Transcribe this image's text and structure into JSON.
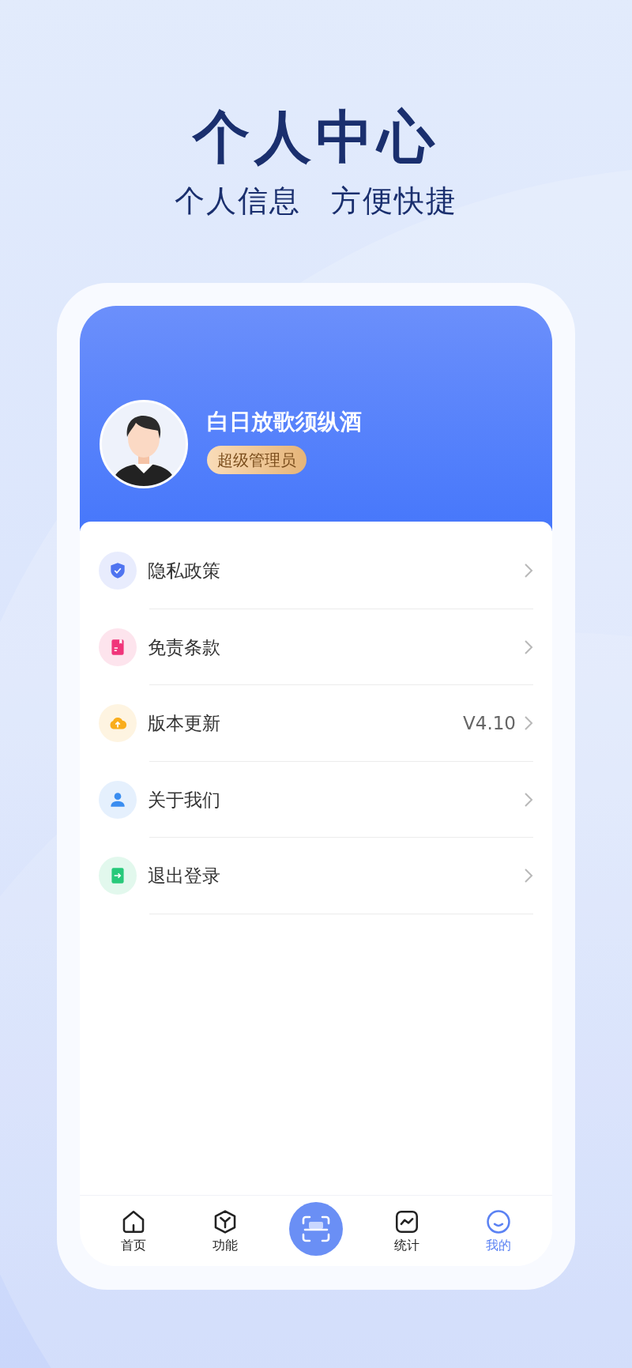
{
  "headline": {
    "title": "个人中心",
    "subtitle": [
      "个人信息",
      "方便快捷"
    ]
  },
  "profile": {
    "name": "白日放歌须纵酒",
    "role": "超级管理员"
  },
  "menu": [
    {
      "kind": "shield",
      "label": "隐私政策",
      "color": "#4f74f0"
    },
    {
      "kind": "document",
      "label": "免责条款",
      "color": "#f0357a"
    },
    {
      "kind": "cloud",
      "label": "版本更新",
      "value": "V4.10",
      "color": "#f9ad1c"
    },
    {
      "kind": "person",
      "label": "关于我们",
      "color": "#3a8df0"
    },
    {
      "kind": "exit",
      "label": "退出登录",
      "color": "#27c97a"
    }
  ],
  "tab_bar": [
    {
      "kind": "home",
      "label": "首页",
      "selected": false
    },
    {
      "kind": "cube",
      "label": "功能",
      "selected": false
    },
    {
      "kind": "scan"
    },
    {
      "kind": "chart",
      "label": "统计",
      "selected": false
    },
    {
      "kind": "smile",
      "label": "我的",
      "selected": true
    }
  ]
}
